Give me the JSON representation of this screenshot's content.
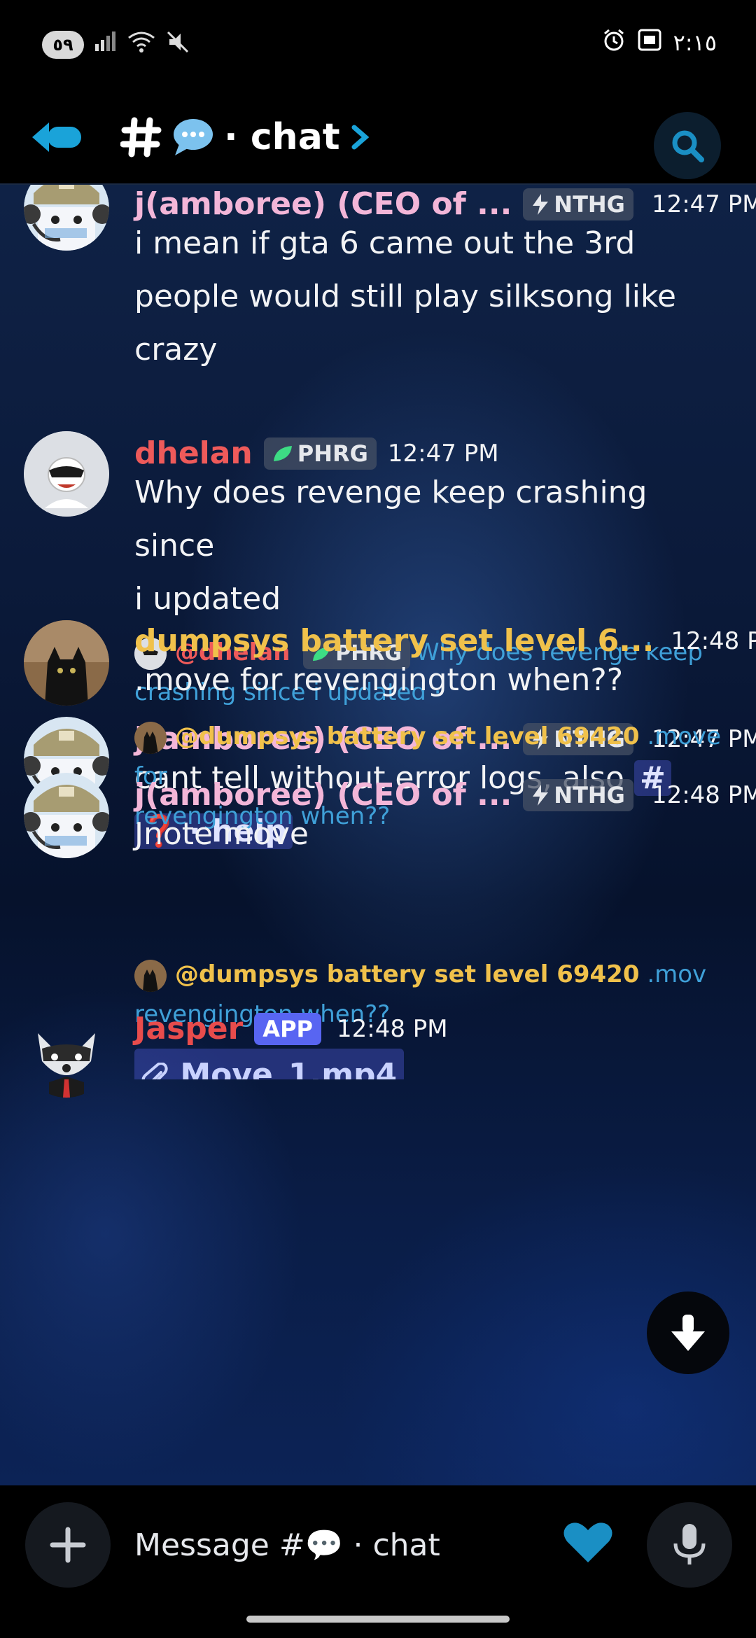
{
  "status": {
    "battery": "٥٩",
    "time": "٢:١٥"
  },
  "header": {
    "channel_name": "· chat"
  },
  "messages": [
    {
      "author": "j(amboree) (CEO of ...",
      "tag": "NTHG",
      "time": "12:47 PM",
      "lines": [
        "i mean if gta 6 came out the 3rd",
        "people would still play silksong like",
        "crazy"
      ]
    },
    {
      "author": "dhelan",
      "tag": "PHRG",
      "time": "12:47 PM",
      "lines": [
        "Why does revenge keep crashing since",
        "i updated"
      ]
    },
    {
      "reply_author": "@dhelan",
      "reply_tag": "PHRG",
      "reply_text_1": "Why does revenge keep",
      "reply_text_2": "crashing since i updated ·",
      "author": "j(amboree) (CEO of ...",
      "tag": "NTHG",
      "time": "12:47 PM",
      "line1": "cant tell without error logs, also",
      "channel_hash": "#",
      "channel_mention": "❓ · help"
    },
    {
      "author": "dumpsys battery set level 6...",
      "time": "12:48 PM",
      "lines": [
        ".move for revengington when??"
      ]
    },
    {
      "reply_author": "@dumpsys battery set level 69420",
      "reply_text_1": ".move for",
      "reply_text_2": "revengington when??",
      "author": "j(amboree) (CEO of ...",
      "tag": "NTHG",
      "time": "12:48 PM",
      "lines": [
        "Jnote move"
      ]
    },
    {
      "reply_author": "@dumpsys battery set level 69420",
      "reply_text_1": ".mov",
      "reply_text_2": "revengington when??",
      "author": "Jasper",
      "badge": "APP",
      "time": "12:48 PM",
      "attachment": "Move_1.mp4"
    }
  ],
  "composer": {
    "placeholder": "Message #💬 · chat"
  },
  "colors": {
    "jamboree": "#f3b6d8",
    "dhelan": "#ee5a5a",
    "dumpsys": "#f0c14b",
    "jasper": "#e84c4c",
    "accent": "#1aa3d9"
  }
}
